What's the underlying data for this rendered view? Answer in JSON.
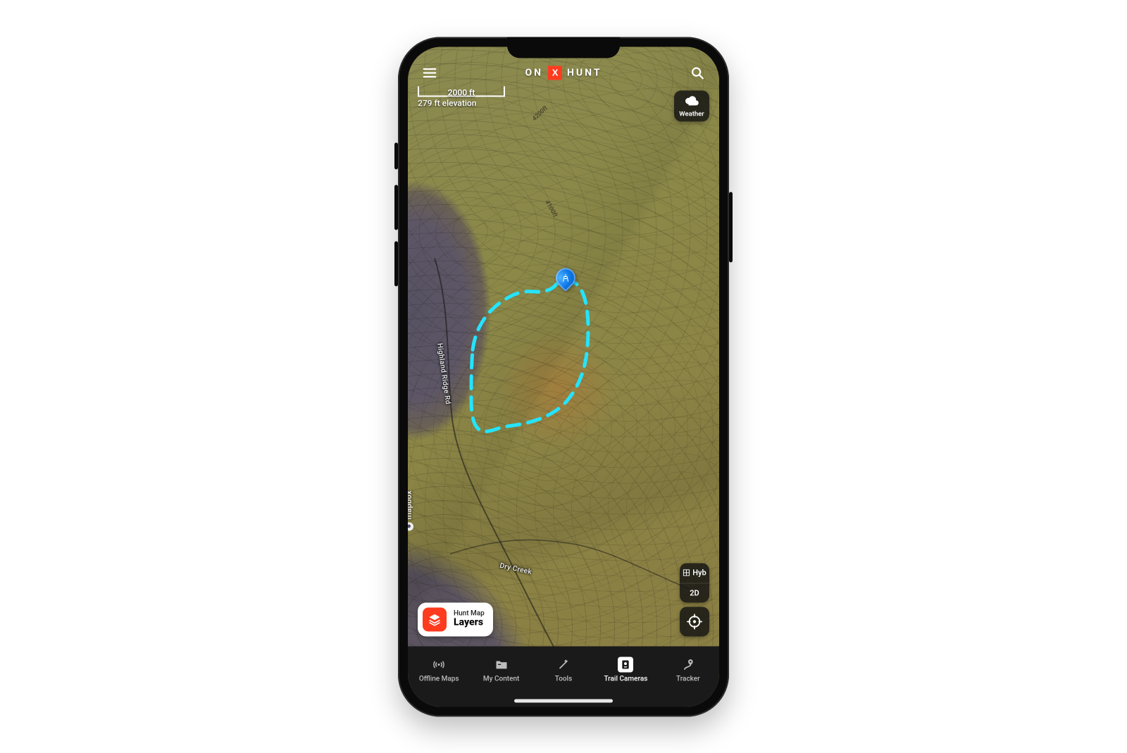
{
  "header": {
    "brand_left": "ON",
    "brand_x": "X",
    "brand_right": "HUNT"
  },
  "scale": {
    "distance": "2000 ft",
    "elevation": "279 ft elevation"
  },
  "weather": {
    "label": "Weather"
  },
  "layers": {
    "subtitle": "Hunt Map",
    "title": "Layers"
  },
  "map_mode": {
    "hybrid": "Hyb",
    "dim": "2D"
  },
  "map_labels": {
    "highland_ridge": "Highland Ridge Rd",
    "dry_creek": "Dry Creek",
    "elev_4100": "4100ft",
    "elev_4200": "4200ft"
  },
  "attribution": {
    "mapbox": "mapbox"
  },
  "bottom_tabs": [
    {
      "id": "offline-maps",
      "label": "Offline Maps",
      "icon": "broadcast-icon"
    },
    {
      "id": "my-content",
      "label": "My Content",
      "icon": "folder-icon"
    },
    {
      "id": "tools",
      "label": "Tools",
      "icon": "wand-icon"
    },
    {
      "id": "trail-cameras",
      "label": "Trail Cameras",
      "icon": "camera-icon",
      "active": true
    },
    {
      "id": "tracker",
      "label": "Tracker",
      "icon": "route-pin-icon"
    }
  ]
}
